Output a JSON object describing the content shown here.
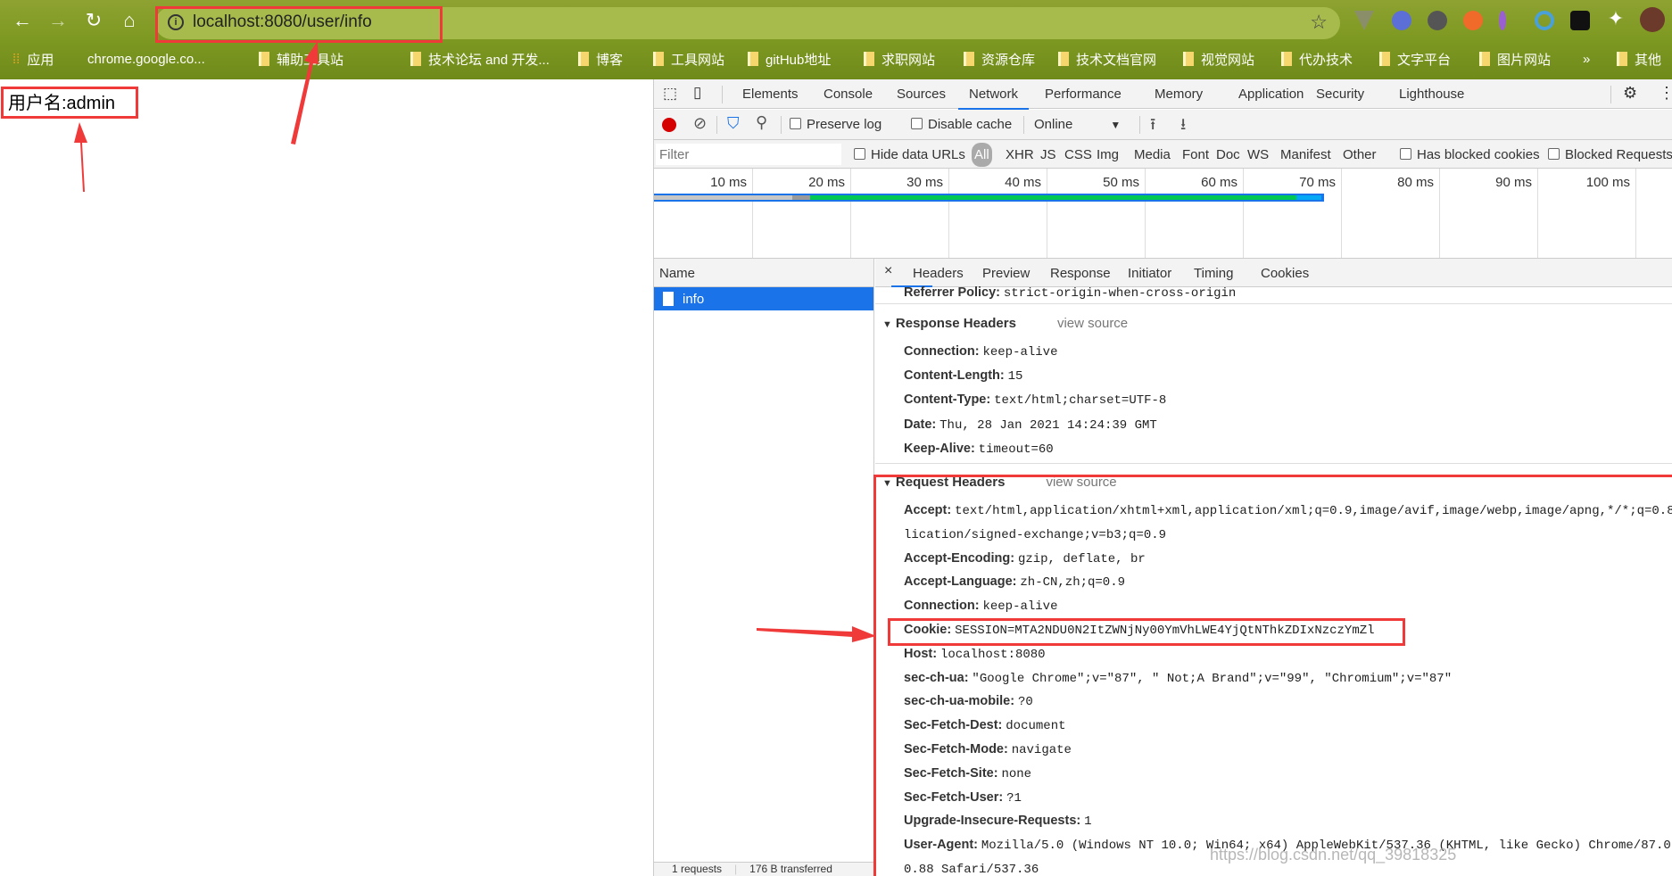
{
  "browser": {
    "url": "localhost:8080/user/info",
    "bookmarks": [
      "应用",
      "chrome.google.co...",
      "辅助工具站",
      "技术论坛 and 开发...",
      "博客",
      "工具网站",
      "gitHub地址",
      "求职网站",
      "资源仓库",
      "技术文档官网",
      "视觉网站",
      "代办技术",
      "文字平台",
      "图片网站",
      "»",
      "其他"
    ]
  },
  "page": {
    "username_text": "用户名:admin"
  },
  "devtools": {
    "tabs": [
      "Elements",
      "Console",
      "Sources",
      "Network",
      "Performance",
      "Memory",
      "Application",
      "Security",
      "Lighthouse"
    ],
    "active_tab": "Network",
    "toolbar": {
      "preserve_log": "Preserve log",
      "disable_cache": "Disable cache",
      "throttle": "Online"
    },
    "filter": {
      "placeholder": "Filter",
      "hide_data_urls": "Hide data URLs",
      "types": [
        "All",
        "XHR",
        "JS",
        "CSS",
        "Img",
        "Media",
        "Font",
        "Doc",
        "WS",
        "Manifest",
        "Other"
      ],
      "has_blocked_cookies": "Has blocked cookies",
      "blocked_requests": "Blocked Requests"
    },
    "timeline_ticks": [
      "10 ms",
      "20 ms",
      "30 ms",
      "40 ms",
      "50 ms",
      "60 ms",
      "70 ms",
      "80 ms",
      "90 ms",
      "100 ms"
    ],
    "name_header": "Name",
    "requests": [
      {
        "name": "info"
      }
    ],
    "status": {
      "requests": "1 requests",
      "transferred": "176 B transferred"
    },
    "detail_tabs": [
      "Headers",
      "Preview",
      "Response",
      "Initiator",
      "Timing",
      "Cookies"
    ],
    "referrer": {
      "name": "Referrer Policy:",
      "value": "strict-origin-when-cross-origin"
    },
    "response_headers": {
      "title": "Response Headers",
      "view_source": "view source",
      "items": [
        {
          "name": "Connection:",
          "value": "keep-alive"
        },
        {
          "name": "Content-Length:",
          "value": "15"
        },
        {
          "name": "Content-Type:",
          "value": "text/html;charset=UTF-8"
        },
        {
          "name": "Date:",
          "value": "Thu, 28 Jan 2021 14:24:39 GMT"
        },
        {
          "name": "Keep-Alive:",
          "value": "timeout=60"
        }
      ]
    },
    "request_headers": {
      "title": "Request Headers",
      "view_source": "view source",
      "items": [
        {
          "name": "Accept:",
          "value": "text/html,application/xhtml+xml,application/xml;q=0.9,image/avif,image/webp,image/apng,*/*;q=0.8,"
        },
        {
          "name": "",
          "value": "lication/signed-exchange;v=b3;q=0.9"
        },
        {
          "name": "Accept-Encoding:",
          "value": "gzip, deflate, br"
        },
        {
          "name": "Accept-Language:",
          "value": "zh-CN,zh;q=0.9"
        },
        {
          "name": "Connection:",
          "value": "keep-alive"
        },
        {
          "name": "Cookie:",
          "value": "SESSION=MTA2NDU0N2ItZWNjNy00YmVhLWE4YjQtNThkZDIxNzczYmZl"
        },
        {
          "name": "Host:",
          "value": "localhost:8080"
        },
        {
          "name": "sec-ch-ua:",
          "value": "\"Google Chrome\";v=\"87\", \" Not;A Brand\";v=\"99\", \"Chromium\";v=\"87\""
        },
        {
          "name": "sec-ch-ua-mobile:",
          "value": "?0"
        },
        {
          "name": "Sec-Fetch-Dest:",
          "value": "document"
        },
        {
          "name": "Sec-Fetch-Mode:",
          "value": "navigate"
        },
        {
          "name": "Sec-Fetch-Site:",
          "value": "none"
        },
        {
          "name": "Sec-Fetch-User:",
          "value": "?1"
        },
        {
          "name": "Upgrade-Insecure-Requests:",
          "value": "1"
        },
        {
          "name": "User-Agent:",
          "value": "Mozilla/5.0 (Windows NT 10.0; Win64; x64) AppleWebKit/537.36 (KHTML, like Gecko) Chrome/87.0.4280"
        },
        {
          "name": "",
          "value": "0.88 Safari/537.36"
        }
      ]
    },
    "watermark": "https://blog.csdn.net/qq_39818325"
  },
  "colors": {
    "annotation_red": "#f03a3a",
    "accent_blue": "#1a73e8",
    "record_red": "#d50000"
  }
}
